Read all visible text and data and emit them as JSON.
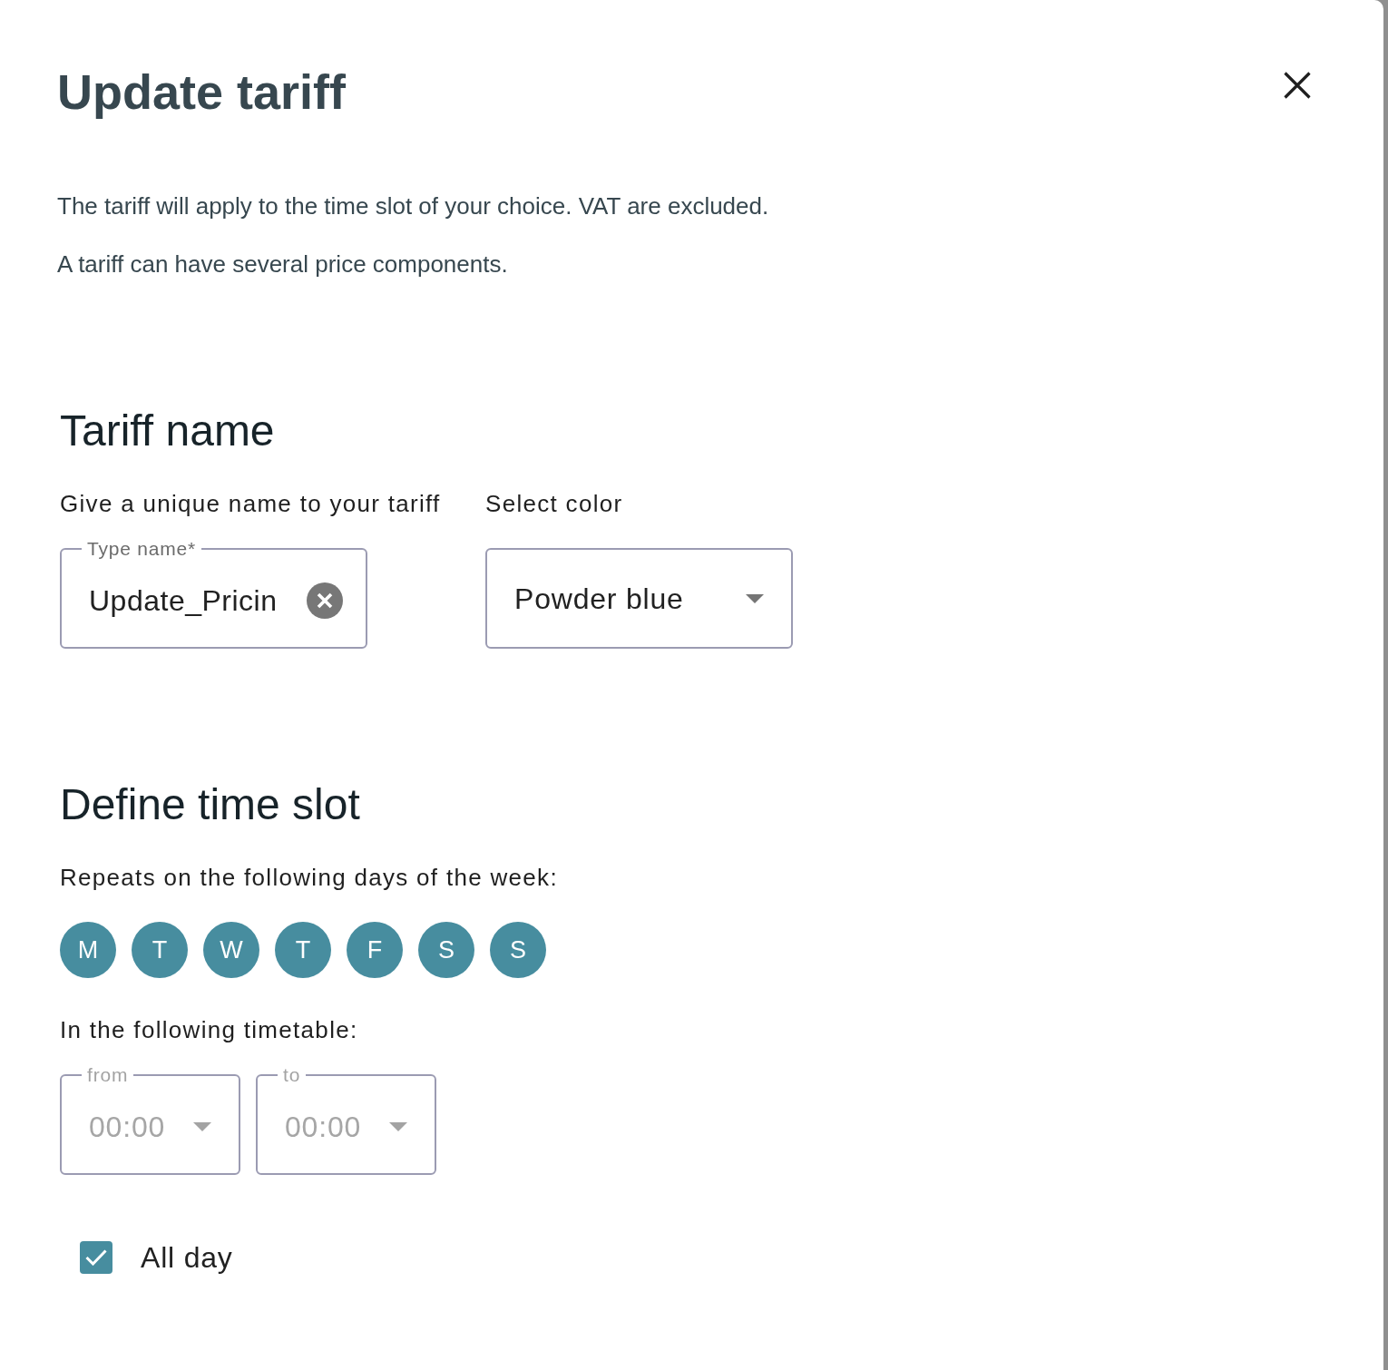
{
  "dialog": {
    "title": "Update tariff"
  },
  "intro": [
    "The tariff will apply to the time slot of your choice. VAT are excluded.",
    "A tariff can have several price components."
  ],
  "tariff_name": {
    "heading": "Tariff name",
    "name_prompt": "Give a unique name to your tariff",
    "name_field": {
      "label": "Type name*",
      "value": "Update_Pricin"
    },
    "color_prompt": "Select color",
    "color_select": {
      "value": "Powder blue"
    }
  },
  "time_slot": {
    "heading": "Define time slot",
    "days_prompt": "Repeats on the following days of the week:",
    "days": [
      {
        "label": "M",
        "selected": true
      },
      {
        "label": "T",
        "selected": true
      },
      {
        "label": "W",
        "selected": true
      },
      {
        "label": "T",
        "selected": true
      },
      {
        "label": "F",
        "selected": true
      },
      {
        "label": "S",
        "selected": true
      },
      {
        "label": "S",
        "selected": true
      }
    ],
    "timetable_prompt": "In the following timetable:",
    "from_field": {
      "label": "from",
      "value": "00:00",
      "disabled": true
    },
    "to_field": {
      "label": "to",
      "value": "00:00",
      "disabled": true
    },
    "all_day": {
      "label": "All day",
      "checked": true
    }
  }
}
